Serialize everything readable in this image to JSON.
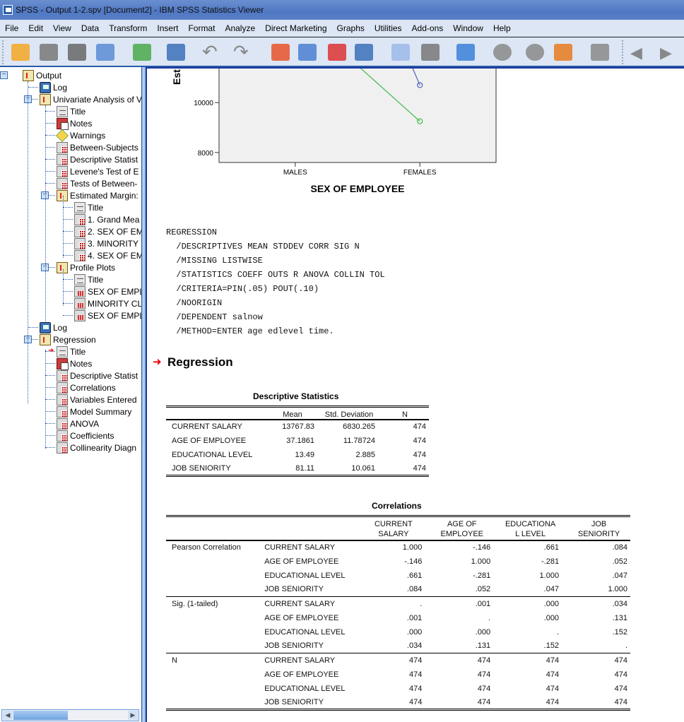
{
  "window": {
    "title": "SPSS - Output 1-2.spv [Document2] - IBM SPSS Statistics Viewer"
  },
  "menu": [
    "File",
    "Edit",
    "View",
    "Data",
    "Transform",
    "Insert",
    "Format",
    "Analyze",
    "Direct Marketing",
    "Graphs",
    "Utilities",
    "Add-ons",
    "Window",
    "Help"
  ],
  "toolbar": [
    "open-icon",
    "save-icon",
    "print-icon",
    "print-preview-icon",
    "export-icon",
    "recall-dialog-icon",
    "undo-icon",
    "redo-icon",
    "goto-case-icon",
    "goto-variable-icon",
    "insert-cases-icon",
    "variables-icon",
    "show-all-variables-icon",
    "use-sets-icon",
    "designate-window-icon",
    "promote-icon",
    "demote-icon",
    "run-script-icon",
    "collapse-icon",
    "back-icon",
    "forward-icon"
  ],
  "outline": {
    "items": [
      {
        "label": "Output",
        "icon": "book",
        "level": 0
      },
      {
        "label": "Log",
        "icon": "log",
        "level": 1
      },
      {
        "label": "Univariate Analysis of V",
        "icon": "book",
        "level": 1
      },
      {
        "label": "Title",
        "icon": "page",
        "level": 2
      },
      {
        "label": "Notes",
        "icon": "notes",
        "level": 2
      },
      {
        "label": "Warnings",
        "icon": "warn",
        "level": 2
      },
      {
        "label": "Between-Subjects",
        "icon": "table",
        "level": 2
      },
      {
        "label": "Descriptive Statist",
        "icon": "table",
        "level": 2
      },
      {
        "label": "Levene's Test of E",
        "icon": "table",
        "level": 2
      },
      {
        "label": "Tests of Between-",
        "icon": "table",
        "level": 2
      },
      {
        "label": "Estimated Margin:",
        "icon": "book",
        "level": 2
      },
      {
        "label": "Title",
        "icon": "page",
        "level": 3
      },
      {
        "label": "1. Grand Mea",
        "icon": "table",
        "level": 3
      },
      {
        "label": "2. SEX OF EM",
        "icon": "table",
        "level": 3
      },
      {
        "label": "3. MINORITY",
        "icon": "table",
        "level": 3
      },
      {
        "label": "4. SEX OF EM",
        "icon": "table",
        "level": 3
      },
      {
        "label": "Profile Plots",
        "icon": "book",
        "level": 2
      },
      {
        "label": "Title",
        "icon": "page",
        "level": 3
      },
      {
        "label": "SEX OF EMPL",
        "icon": "chart",
        "level": 3
      },
      {
        "label": "MINORITY CL",
        "icon": "chart",
        "level": 3
      },
      {
        "label": "SEX OF EMPL",
        "icon": "chart",
        "level": 3
      },
      {
        "label": "Log",
        "icon": "log",
        "level": 1
      },
      {
        "label": "Regression",
        "icon": "book",
        "level": 1
      },
      {
        "label": "Title",
        "icon": "page",
        "level": 2,
        "selected": true
      },
      {
        "label": "Notes",
        "icon": "notes",
        "level": 2
      },
      {
        "label": "Descriptive Statist",
        "icon": "table",
        "level": 2
      },
      {
        "label": "Correlations",
        "icon": "table",
        "level": 2
      },
      {
        "label": "Variables Entered",
        "icon": "table",
        "level": 2
      },
      {
        "label": "Model Summary",
        "icon": "table",
        "level": 2
      },
      {
        "label": "ANOVA",
        "icon": "table",
        "level": 2
      },
      {
        "label": "Coefficients",
        "icon": "table",
        "level": 2
      },
      {
        "label": "Collinearity Diagn",
        "icon": "table",
        "level": 2
      }
    ]
  },
  "plot": {
    "y_axis_label_partial": "Est",
    "y_ticks": [
      "10000",
      "8000"
    ],
    "x_ticks": [
      "MALES",
      "FEMALES"
    ],
    "x_title": "SEX OF EMPLOYEE",
    "series": [
      {
        "name": "blue",
        "color": "#4a62b8",
        "female_value": 10700
      },
      {
        "name": "green",
        "color": "#3fb84a",
        "female_value": 9250
      }
    ]
  },
  "syntax": [
    "REGRESSION",
    "  /DESCRIPTIVES MEAN STDDEV CORR SIG N",
    "  /MISSING LISTWISE",
    "  /STATISTICS COEFF OUTS R ANOVA COLLIN TOL",
    "  /CRITERIA=PIN(.05) POUT(.10)",
    "  /NOORIGIN",
    "  /DEPENDENT salnow",
    "  /METHOD=ENTER age edlevel time."
  ],
  "section_title": "Regression",
  "descriptives": {
    "title": "Descriptive Statistics",
    "headers": [
      "",
      "Mean",
      "Std. Deviation",
      "N"
    ],
    "rows": [
      [
        "CURRENT SALARY",
        "13767.83",
        "6830.265",
        "474"
      ],
      [
        "AGE OF EMPLOYEE",
        "37.1861",
        "11.78724",
        "474"
      ],
      [
        "EDUCATIONAL LEVEL",
        "13.49",
        "2.885",
        "474"
      ],
      [
        "JOB SENIORITY",
        "81.11",
        "10.061",
        "474"
      ]
    ]
  },
  "correlations": {
    "title": "Correlations",
    "headers": [
      [
        "CURRENT",
        "SALARY"
      ],
      [
        "AGE OF",
        "EMPLOYEE"
      ],
      [
        "EDUCATIONA",
        "L LEVEL"
      ],
      [
        "JOB",
        "SENIORITY"
      ]
    ],
    "groups": [
      {
        "label": "Pearson Correlation",
        "rows": [
          [
            "CURRENT SALARY",
            "1.000",
            "-.146",
            ".661",
            ".084"
          ],
          [
            "AGE OF EMPLOYEE",
            "-.146",
            "1.000",
            "-.281",
            ".052"
          ],
          [
            "EDUCATIONAL LEVEL",
            ".661",
            "-.281",
            "1.000",
            ".047"
          ],
          [
            "JOB SENIORITY",
            ".084",
            ".052",
            ".047",
            "1.000"
          ]
        ]
      },
      {
        "label": "Sig. (1-tailed)",
        "rows": [
          [
            "CURRENT SALARY",
            ".",
            ".001",
            ".000",
            ".034"
          ],
          [
            "AGE OF EMPLOYEE",
            ".001",
            ".",
            ".000",
            ".131"
          ],
          [
            "EDUCATIONAL LEVEL",
            ".000",
            ".000",
            ".",
            ".152"
          ],
          [
            "JOB SENIORITY",
            ".034",
            ".131",
            ".152",
            "."
          ]
        ]
      },
      {
        "label": "N",
        "rows": [
          [
            "CURRENT SALARY",
            "474",
            "474",
            "474",
            "474"
          ],
          [
            "AGE OF EMPLOYEE",
            "474",
            "474",
            "474",
            "474"
          ],
          [
            "EDUCATIONAL LEVEL",
            "474",
            "474",
            "474",
            "474"
          ],
          [
            "JOB SENIORITY",
            "474",
            "474",
            "474",
            "474"
          ]
        ]
      }
    ]
  }
}
